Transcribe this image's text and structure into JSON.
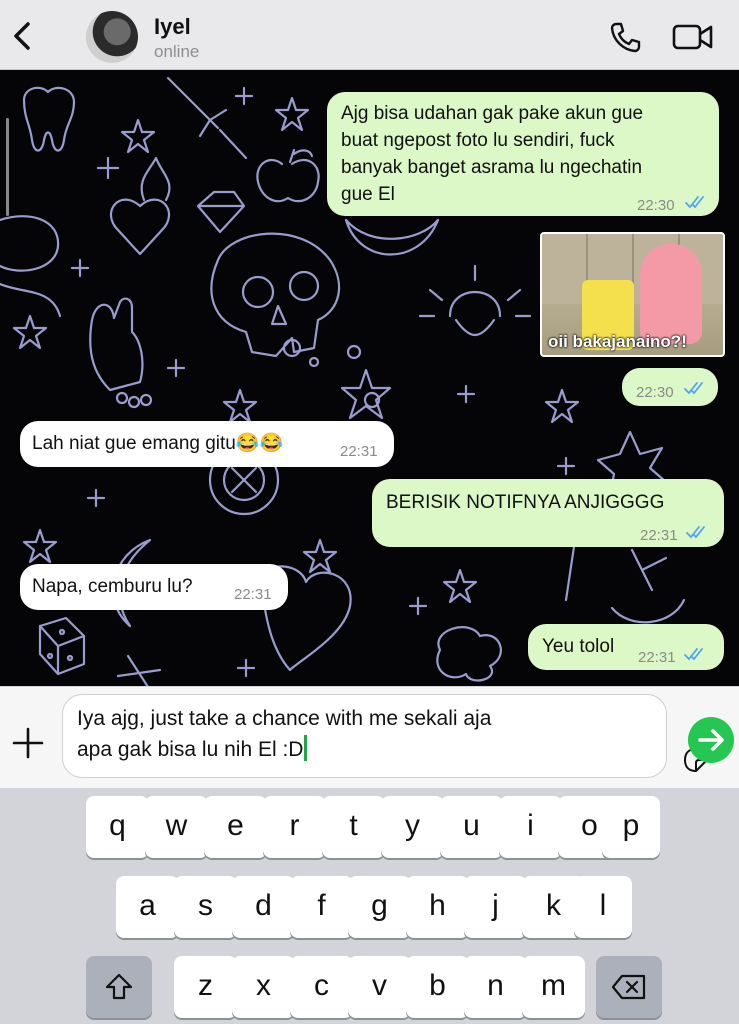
{
  "header": {
    "contact_name": "Iyel",
    "contact_status": "online"
  },
  "messages": [
    {
      "direction": "out",
      "lines": [
        "Ajg bisa udahan gak pake akun gue",
        "buat ngepost foto lu sendiri, fuck",
        "banyak banget asrama lu ngechatin",
        "gue El"
      ],
      "time": "22:30",
      "read": true
    },
    {
      "direction": "out",
      "type": "sticker",
      "sticker_caption": "oii bakajanaino?!",
      "time": "22:30",
      "read": true
    },
    {
      "direction": "in",
      "text": "Lah niat gue emang gitu😂😂",
      "time": "22:31"
    },
    {
      "direction": "out",
      "text": "BERISIK NOTIFNYA ANJIGGGG",
      "time": "22:31",
      "read": true
    },
    {
      "direction": "in",
      "text": "Napa, cemburu lu?",
      "time": "22:31"
    },
    {
      "direction": "out",
      "text": "Yeu tolol",
      "time": "22:31",
      "read": true
    }
  ],
  "composer": {
    "lines": [
      "Iya ajg, just take a chance with me sekali aja",
      "apa gak bisa lu nih El :D"
    ]
  },
  "keyboard": {
    "row1": [
      "q",
      "w",
      "e",
      "r",
      "t",
      "y",
      "u",
      "i",
      "o",
      "p"
    ],
    "row2": [
      "a",
      "s",
      "d",
      "f",
      "g",
      "h",
      "j",
      "k",
      "l"
    ],
    "row3": [
      "z",
      "x",
      "c",
      "v",
      "b",
      "n",
      "m"
    ]
  },
  "colors": {
    "outgoing_bubble": "#dcf8c6",
    "incoming_bubble": "#ffffff",
    "read_ticks": "#4fa3f7",
    "send_button": "#25c652",
    "doodle_stroke": "#9a9ccf"
  }
}
